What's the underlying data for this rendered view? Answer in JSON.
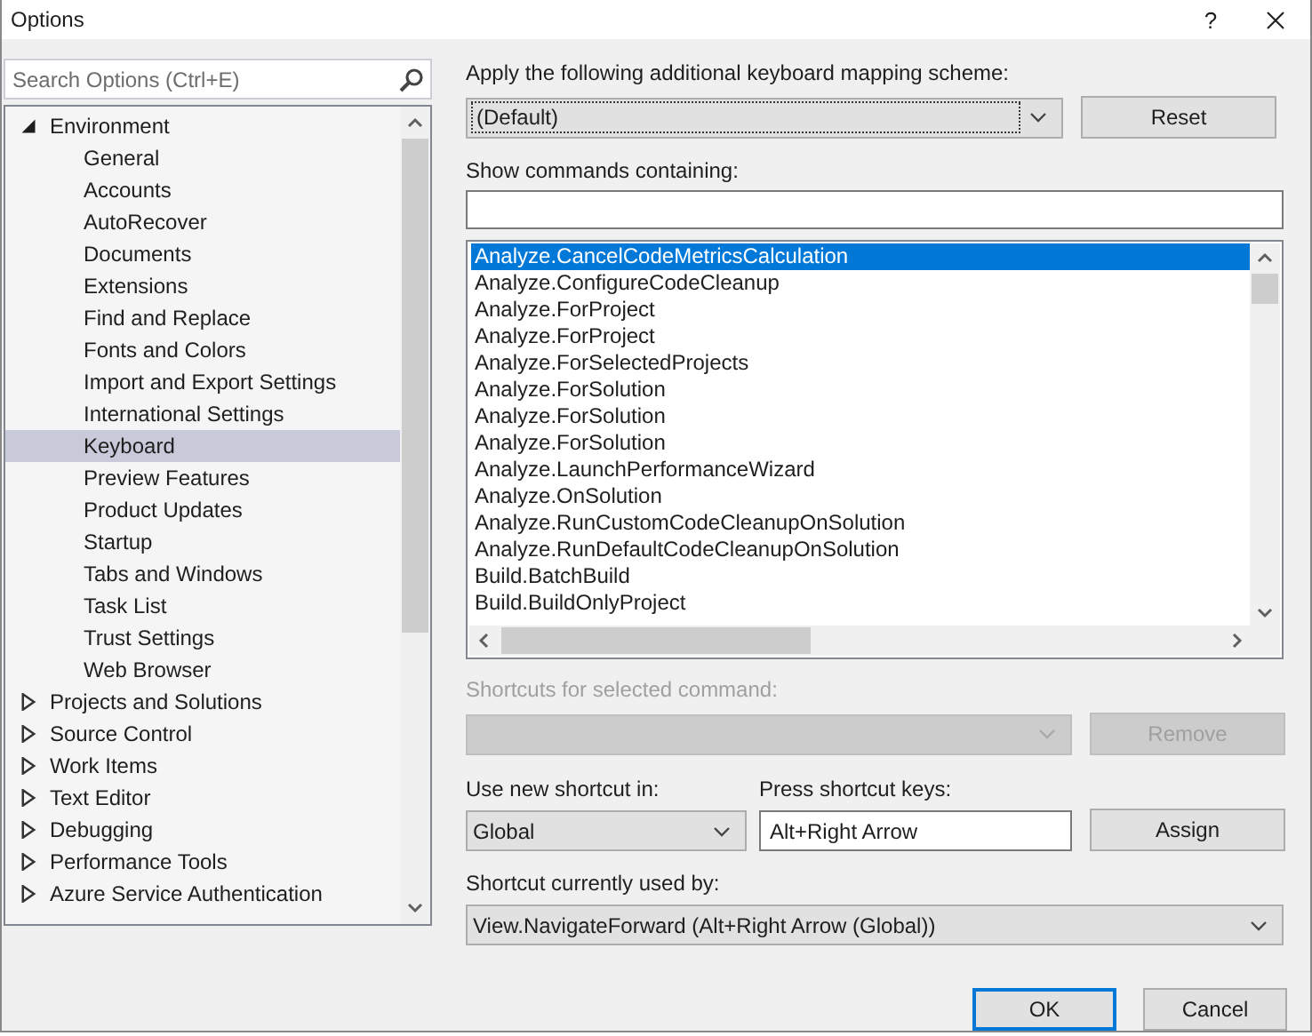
{
  "window": {
    "title": "Options",
    "help": "?"
  },
  "search": {
    "placeholder": "Search Options (Ctrl+E)"
  },
  "tree": [
    {
      "label": "Environment",
      "expanded": true,
      "selected": false,
      "children": [
        {
          "label": "General",
          "selected": false
        },
        {
          "label": "Accounts",
          "selected": false
        },
        {
          "label": "AutoRecover",
          "selected": false
        },
        {
          "label": "Documents",
          "selected": false
        },
        {
          "label": "Extensions",
          "selected": false
        },
        {
          "label": "Find and Replace",
          "selected": false
        },
        {
          "label": "Fonts and Colors",
          "selected": false
        },
        {
          "label": "Import and Export Settings",
          "selected": false
        },
        {
          "label": "International Settings",
          "selected": false
        },
        {
          "label": "Keyboard",
          "selected": true
        },
        {
          "label": "Preview Features",
          "selected": false
        },
        {
          "label": "Product Updates",
          "selected": false
        },
        {
          "label": "Startup",
          "selected": false
        },
        {
          "label": "Tabs and Windows",
          "selected": false
        },
        {
          "label": "Task List",
          "selected": false
        },
        {
          "label": "Trust Settings",
          "selected": false
        },
        {
          "label": "Web Browser",
          "selected": false
        }
      ]
    },
    {
      "label": "Projects and Solutions",
      "expanded": false,
      "selected": false
    },
    {
      "label": "Source Control",
      "expanded": false,
      "selected": false
    },
    {
      "label": "Work Items",
      "expanded": false,
      "selected": false
    },
    {
      "label": "Text Editor",
      "expanded": false,
      "selected": false
    },
    {
      "label": "Debugging",
      "expanded": false,
      "selected": false
    },
    {
      "label": "Performance Tools",
      "expanded": false,
      "selected": false
    },
    {
      "label": "Azure Service Authentication",
      "expanded": false,
      "selected": false
    }
  ],
  "mapping_scheme": {
    "label": "Apply the following additional keyboard mapping scheme:",
    "value": "(Default)",
    "reset_button": "Reset"
  },
  "show_commands": {
    "label": "Show commands containing:"
  },
  "commands": [
    {
      "name": "Analyze.CancelCodeMetricsCalculation",
      "selected": true
    },
    {
      "name": "Analyze.ConfigureCodeCleanup",
      "selected": false
    },
    {
      "name": "Analyze.ForProject",
      "selected": false
    },
    {
      "name": "Analyze.ForProject",
      "selected": false
    },
    {
      "name": "Analyze.ForSelectedProjects",
      "selected": false
    },
    {
      "name": "Analyze.ForSolution",
      "selected": false
    },
    {
      "name": "Analyze.ForSolution",
      "selected": false
    },
    {
      "name": "Analyze.ForSolution",
      "selected": false
    },
    {
      "name": "Analyze.LaunchPerformanceWizard",
      "selected": false
    },
    {
      "name": "Analyze.OnSolution",
      "selected": false
    },
    {
      "name": "Analyze.RunCustomCodeCleanupOnSolution",
      "selected": false
    },
    {
      "name": "Analyze.RunDefaultCodeCleanupOnSolution",
      "selected": false
    },
    {
      "name": "Build.BatchBuild",
      "selected": false
    },
    {
      "name": "Build.BuildOnlyProject",
      "selected": false
    }
  ],
  "shortcuts_for_selected": {
    "label": "Shortcuts for selected command:",
    "disabled": true,
    "remove_button": "Remove"
  },
  "use_new_shortcut_in": {
    "label": "Use new shortcut in:",
    "value": "Global"
  },
  "press_shortcut_keys": {
    "label": "Press shortcut keys:",
    "value": "Alt+Right Arrow",
    "assign_button": "Assign"
  },
  "currently_used_by": {
    "label": "Shortcut currently used by:",
    "value": "View.NavigateForward (Alt+Right Arrow (Global))"
  },
  "buttons": [
    {
      "label": "OK",
      "default": true
    },
    {
      "label": "Cancel",
      "default": false
    }
  ]
}
